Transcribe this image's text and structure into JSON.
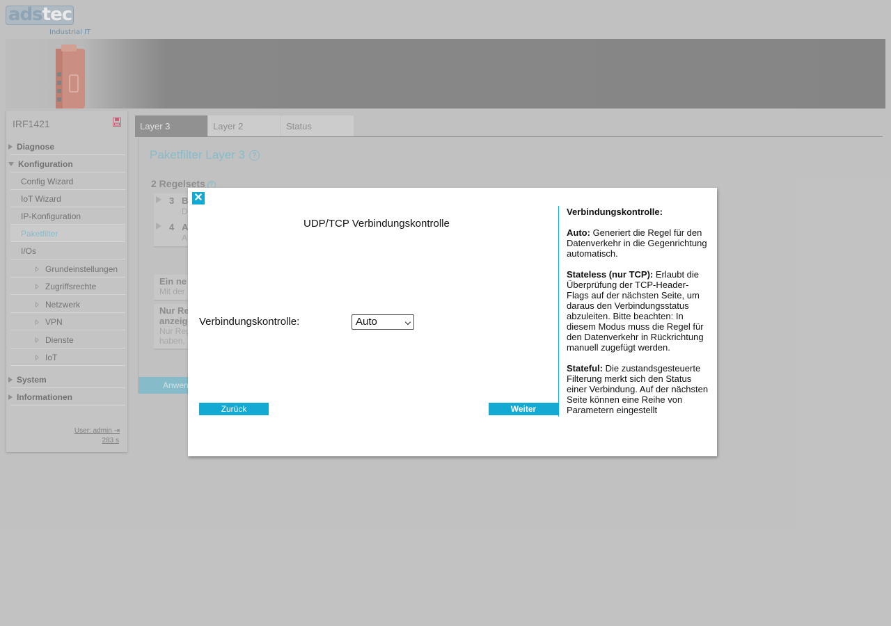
{
  "header": {
    "logo_brand_a": "ads",
    "logo_brand_b": "tec",
    "logo_sub": "Industrial IT"
  },
  "sidebar": {
    "device_name": "IRF1421",
    "sections": {
      "diagnose": "Diagnose",
      "konfiguration": "Konfiguration",
      "system": "System",
      "informationen": "Informationen"
    },
    "konfig_items": [
      "Config Wizard",
      "IoT Wizard",
      "IP-Konfiguration",
      "Paketfilter",
      "I/Os"
    ],
    "sub_items": [
      "Grundeinstellungen",
      "Zugriffsrechte",
      "Netzwerk",
      "VPN",
      "Dienste",
      "IoT"
    ],
    "user_label": "User: admin",
    "session_timer": "283 s"
  },
  "tabs": [
    "Layer 3",
    "Layer 2",
    "Status"
  ],
  "content": {
    "page_title": "Paketfilter Layer 3",
    "rulesets_title": "2 Regelsets",
    "rules": [
      {
        "num": "3",
        "name": "B",
        "desc": "D"
      },
      {
        "num": "4",
        "name": "A",
        "desc": "A"
      }
    ],
    "info_cards": [
      {
        "title": "Ein ne",
        "desc": "Mit der"
      },
      {
        "title": "Nur Re",
        "title2": "anzeig",
        "desc": "Nur Reg",
        "desc2": "haben,"
      }
    ],
    "apply_label": "Anwen"
  },
  "modal": {
    "title": "UDP/TCP Verbindungskontrolle",
    "field_label": "Verbindungskontrolle:",
    "select_value": "Auto",
    "back_label": "Zurück",
    "next_label": "Weiter",
    "help": {
      "heading": "Verbindungskontrolle:",
      "auto_term": "Auto:",
      "auto_text": "Generiert die Regel für den Datenverkehr in die Gegenrichtung automatisch.",
      "stateless_term": "Stateless (nur TCP):",
      "stateless_text": "Erlaubt die Überprüfung der TCP-Header-Flags auf der nächsten Seite, um daraus den Verbindungsstatus abzuleiten. Bitte beachten: In diesem Modus muss die Regel für den Datenverkehr in Rückrichtung manuell zugefügt werden.",
      "stateful_term": "Stateful:",
      "stateful_text": "Die zustandsgesteuerte Filterung merkt sich den Status einer Verbindung. Auf der nächsten Seite können eine Reihe von Parametern eingestellt"
    }
  },
  "colors": {
    "accent": "#13a9d2",
    "accent_light": "#7fc4d6",
    "background": "#cbcbcb"
  }
}
